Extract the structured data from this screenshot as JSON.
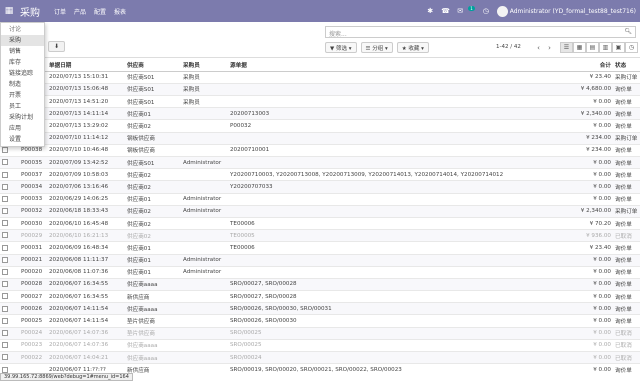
{
  "nav": {
    "apps_icon": "grid-icon",
    "brand": "采购",
    "menu": [
      "订单",
      "产品",
      "配置",
      "报表"
    ],
    "chat_badge": "1",
    "user": "Administrator (YD_formal_test88_test716)"
  },
  "dropdown": {
    "items": [
      "讨论",
      "采购",
      "销售",
      "库存",
      "链接追踪",
      "制造",
      "开票",
      "员工",
      "采购计划",
      "应用",
      "设置"
    ],
    "active": "采购"
  },
  "control": {
    "create_label": "",
    "import_icon": "download-icon",
    "search_placeholder": "搜索...",
    "filter_label": "筛选",
    "group_label": "分组",
    "fav_label": "收藏",
    "pager": "1-42 / 42"
  },
  "table": {
    "headers": [
      "",
      "单据日期",
      "供应商",
      "采购员",
      "源单据",
      "合计",
      "状态"
    ],
    "rows": [
      {
        "ref": "",
        "date": "2020/07/13 15:10:31",
        "vendor": "供应商S01",
        "buyer": "采购员",
        "src": "",
        "total": "¥ 23.40",
        "state": "采购订单",
        "gray": false
      },
      {
        "ref": "",
        "date": "2020/07/13 15:06:48",
        "vendor": "供应商S01",
        "buyer": "采购员",
        "src": "",
        "total": "¥ 4,680.00",
        "state": "询价单",
        "gray": false
      },
      {
        "ref": "",
        "date": "2020/07/13 14:51:20",
        "vendor": "供应商S01",
        "buyer": "采购员",
        "src": "",
        "total": "¥ 0.00",
        "state": "询价单",
        "gray": false
      },
      {
        "ref": "",
        "date": "2020/07/13 14:11:14",
        "vendor": "供应商01",
        "buyer": "",
        "src": "20200713003",
        "total": "¥ 2,340.00",
        "state": "询价单",
        "gray": false
      },
      {
        "ref": "",
        "date": "2020/07/13 13:29:02",
        "vendor": "供应商02",
        "buyer": "",
        "src": "P00032",
        "total": "¥ 0.00",
        "state": "询价单",
        "gray": false
      },
      {
        "ref": "",
        "date": "2020/07/10 11:14:12",
        "vendor": "钢板供应商",
        "buyer": "",
        "src": "",
        "total": "¥ 234.00",
        "state": "采购订单",
        "gray": false
      },
      {
        "ref": "P00038",
        "date": "2020/07/10 10:46:48",
        "vendor": "钢板供应商",
        "buyer": "",
        "src": "20200710001",
        "total": "¥ 234.00",
        "state": "询价单",
        "gray": false
      },
      {
        "ref": "P00035",
        "date": "2020/07/09 13:42:52",
        "vendor": "供应商S01",
        "buyer": "Administrator",
        "src": "",
        "total": "¥ 0.00",
        "state": "询价单",
        "gray": false
      },
      {
        "ref": "P00037",
        "date": "2020/07/09 10:58:03",
        "vendor": "供应商02",
        "buyer": "",
        "src": "Y20200710003, Y20200713008, Y20200713009, Y20200714013, Y20200714014, Y20200714012",
        "total": "¥ 0.00",
        "state": "询价单",
        "gray": false
      },
      {
        "ref": "P00034",
        "date": "2020/07/06 13:16:46",
        "vendor": "供应商02",
        "buyer": "",
        "src": "Y20200707033",
        "total": "¥ 0.00",
        "state": "询价单",
        "gray": false
      },
      {
        "ref": "P00033",
        "date": "2020/06/29 14:06:25",
        "vendor": "供应商01",
        "buyer": "Administrator",
        "src": "",
        "total": "¥ 0.00",
        "state": "询价单",
        "gray": false
      },
      {
        "ref": "P00032",
        "date": "2020/06/18 18:33:43",
        "vendor": "供应商02",
        "buyer": "Administrator",
        "src": "",
        "total": "¥ 2,340.00",
        "state": "采购订单",
        "gray": false
      },
      {
        "ref": "P00030",
        "date": "2020/06/10 16:45:48",
        "vendor": "供应商02",
        "buyer": "",
        "src": "TE00006",
        "total": "¥ 70.20",
        "state": "询价单",
        "gray": false
      },
      {
        "ref": "P00029",
        "date": "2020/06/10 16:21:13",
        "vendor": "供应商02",
        "buyer": "",
        "src": "TE00005",
        "total": "¥ 936.00",
        "state": "已取消",
        "gray": true
      },
      {
        "ref": "P00031",
        "date": "2020/06/09 16:48:34",
        "vendor": "供应商01",
        "buyer": "",
        "src": "TE00006",
        "total": "¥ 23.40",
        "state": "询价单",
        "gray": false
      },
      {
        "ref": "P00021",
        "date": "2020/06/08 11:11:37",
        "vendor": "供应商01",
        "buyer": "Administrator",
        "src": "",
        "total": "¥ 0.00",
        "state": "询价单",
        "gray": false
      },
      {
        "ref": "P00020",
        "date": "2020/06/08 11:07:36",
        "vendor": "供应商01",
        "buyer": "Administrator",
        "src": "",
        "total": "¥ 0.00",
        "state": "询价单",
        "gray": false
      },
      {
        "ref": "P00028",
        "date": "2020/06/07 16:34:55",
        "vendor": "供应商aaaa",
        "buyer": "",
        "src": "SRO/00027, SRO/00028",
        "total": "¥ 0.00",
        "state": "询价单",
        "gray": false
      },
      {
        "ref": "P00027",
        "date": "2020/06/07 16:34:55",
        "vendor": "新供应商",
        "buyer": "",
        "src": "SRO/00027, SRO/00028",
        "total": "¥ 0.00",
        "state": "询价单",
        "gray": false
      },
      {
        "ref": "P00026",
        "date": "2020/06/07 14:11:54",
        "vendor": "供应商aaaa",
        "buyer": "",
        "src": "SRO/00026, SRO/00030, SRO/00031",
        "total": "¥ 0.00",
        "state": "询价单",
        "gray": false
      },
      {
        "ref": "P00025",
        "date": "2020/06/07 14:11:54",
        "vendor": "垫片供应商",
        "buyer": "",
        "src": "SRO/00026, SRO/00030",
        "total": "¥ 0.00",
        "state": "询价单",
        "gray": false
      },
      {
        "ref": "P00024",
        "date": "2020/06/07 14:07:36",
        "vendor": "垫片供应商",
        "buyer": "",
        "src": "SRO/00025",
        "total": "¥ 0.00",
        "state": "已取消",
        "gray": true
      },
      {
        "ref": "P00023",
        "date": "2020/06/07 14:07:36",
        "vendor": "供应商aaaa",
        "buyer": "",
        "src": "SRO/00025",
        "total": "¥ 0.00",
        "state": "已取消",
        "gray": true
      },
      {
        "ref": "P00022",
        "date": "2020/06/07 14:04:21",
        "vendor": "供应商aaaa",
        "buyer": "",
        "src": "SRO/00024",
        "total": "¥ 0.00",
        "state": "已取消",
        "gray": true
      },
      {
        "ref": "",
        "date": "2020/06/07 11:??:??",
        "vendor": "新供应商",
        "buyer": "",
        "src": "SRO/00019, SRO/00020, SRO/00021, SRO/00022, SRO/00023",
        "total": "¥ 0.00",
        "state": "询价单",
        "gray": false
      }
    ]
  },
  "statusbar": "39.99.165.72:8869/web?debug=1#menu_id=164"
}
